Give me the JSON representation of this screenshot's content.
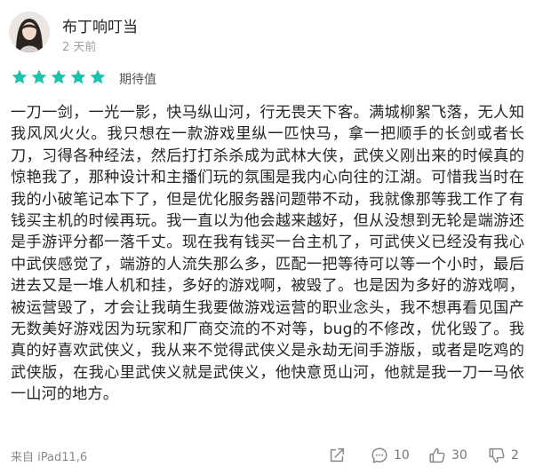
{
  "user": {
    "name": "布丁响叮当",
    "time": "2 天前"
  },
  "rating": {
    "stars": 5,
    "max": 5,
    "label": "期待值",
    "star_color": "#1ec3b0"
  },
  "review": {
    "text": "一刀一剑，一光一影，快马纵山河，行无畏天下客。满城柳絮飞落，无人知我风风火火。我只想在一款游戏里纵一匹快马，拿一把顺手的长剑或者长刀，习得各种经法，然后打打杀杀成为武林大侠，武侠义刚出来的时候真的惊艳我了，那种设计和主播们玩的氛围是我内心向往的江湖。可惜我当时在我的小破笔记本下了，但是优化服务器问题带不动，我就像那等我工作了有钱买主机的时候再玩。我一直以为他会越来越好，但从没想到无轮是端游还是手游评分都一落千丈。现在我有钱买一台主机了，可武侠义已经没有我心中武侠感觉了，端游的人流失那么多，匹配一把等待可以等一个小时，最后进去又是一堆人机和挂，多好的游戏啊，被毁了。也是因为多好的游戏啊，被运营毁了，才会让我萌生我要做游戏运营的职业念头，我不想再看见国产无数美好游戏因为玩家和厂商交流的不对等，bug的不修改，优化毁了。我真的好喜欢武侠义，我从来不觉得武侠义是永劫无间手游版，或者是吃鸡的武侠版，在我心里武侠义就是武侠义，他快意觅山河，他就是我一刀一马依一山河的地方。"
  },
  "footer": {
    "device": "来自 iPad11,6",
    "comments": "10",
    "likes": "30",
    "dislikes": "2"
  },
  "icons": {
    "share": "share-icon",
    "comment": "comment-icon",
    "like": "thumbs-up-icon",
    "dislike": "thumbs-down-icon"
  }
}
